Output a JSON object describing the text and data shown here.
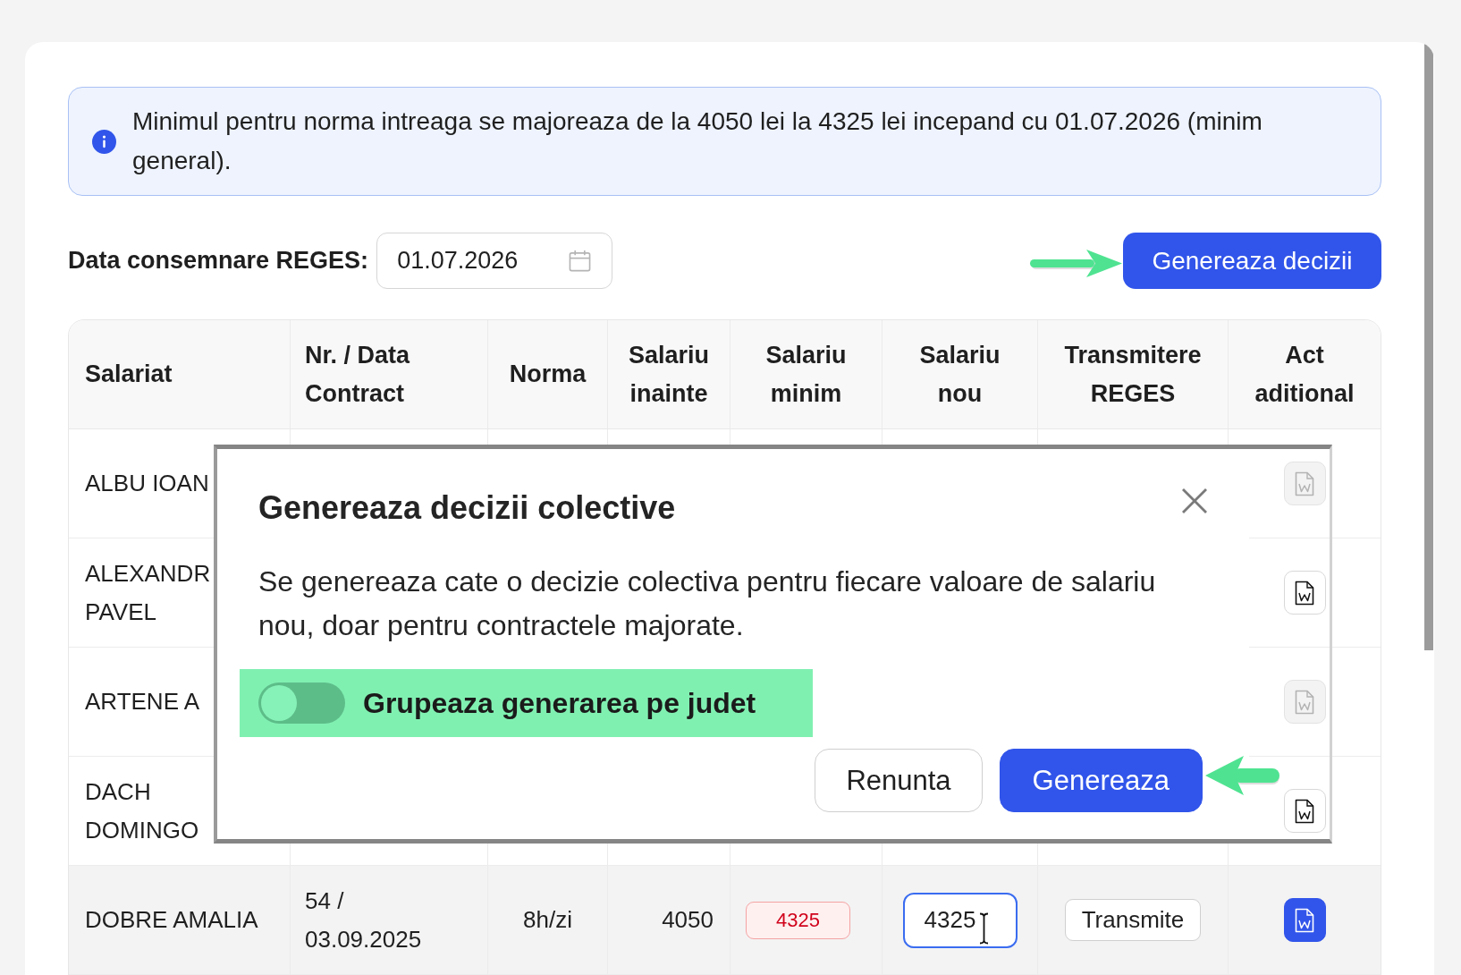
{
  "notice": {
    "text": "Minimul pentru norma intreaga se majoreaza de la 4050 lei la 4325 lei incepand cu 01.07.2026 (minim general)."
  },
  "date_filter": {
    "label": "Data consemnare REGES:",
    "value": "01.07.2026"
  },
  "generate_button": {
    "label": "Genereaza decizii"
  },
  "table": {
    "columns": [
      "Salariat",
      "Nr. / Data Contract",
      "Norma",
      "Salariu inainte",
      "Salariu minim",
      "Salariu nou",
      "Transmitere REGES",
      "Act aditional"
    ],
    "rows": [
      {
        "name": "ALBU IOAN",
        "selected": false,
        "act": {
          "disabled": true,
          "primary": false
        }
      },
      {
        "name": "ALEXANDR PAVEL",
        "selected": false,
        "act": {
          "disabled": false,
          "primary": false
        }
      },
      {
        "name": "ARTENE A",
        "selected": false,
        "act": {
          "disabled": true,
          "primary": false
        }
      },
      {
        "name": "DACH DOMINGO",
        "selected": false,
        "act": {
          "disabled": false,
          "primary": false
        }
      },
      {
        "name": "DOBRE AMALIA",
        "contract": "54 / 03.09.2025",
        "norma": "8h/zi",
        "salary_before": "4050",
        "salary_min": {
          "text": "4325",
          "warning": true
        },
        "salary_new": {
          "value": "4325",
          "focused": true
        },
        "transmit": "Transmite",
        "selected": true,
        "act": {
          "disabled": false,
          "primary": true
        }
      }
    ]
  },
  "dialog": {
    "title": "Genereaza decizii colective",
    "message": "Se genereaza cate o decizie colectiva pentru fiecare valoare de salariu nou, doar pentru contractele majorate.",
    "toggle": {
      "label": "Grupeaza generarea pe judet",
      "on": false,
      "highlighted": true
    },
    "buttons": [
      {
        "label": "Renunta",
        "primary": false
      },
      {
        "label": "Genereaza",
        "primary": true
      }
    ]
  }
}
